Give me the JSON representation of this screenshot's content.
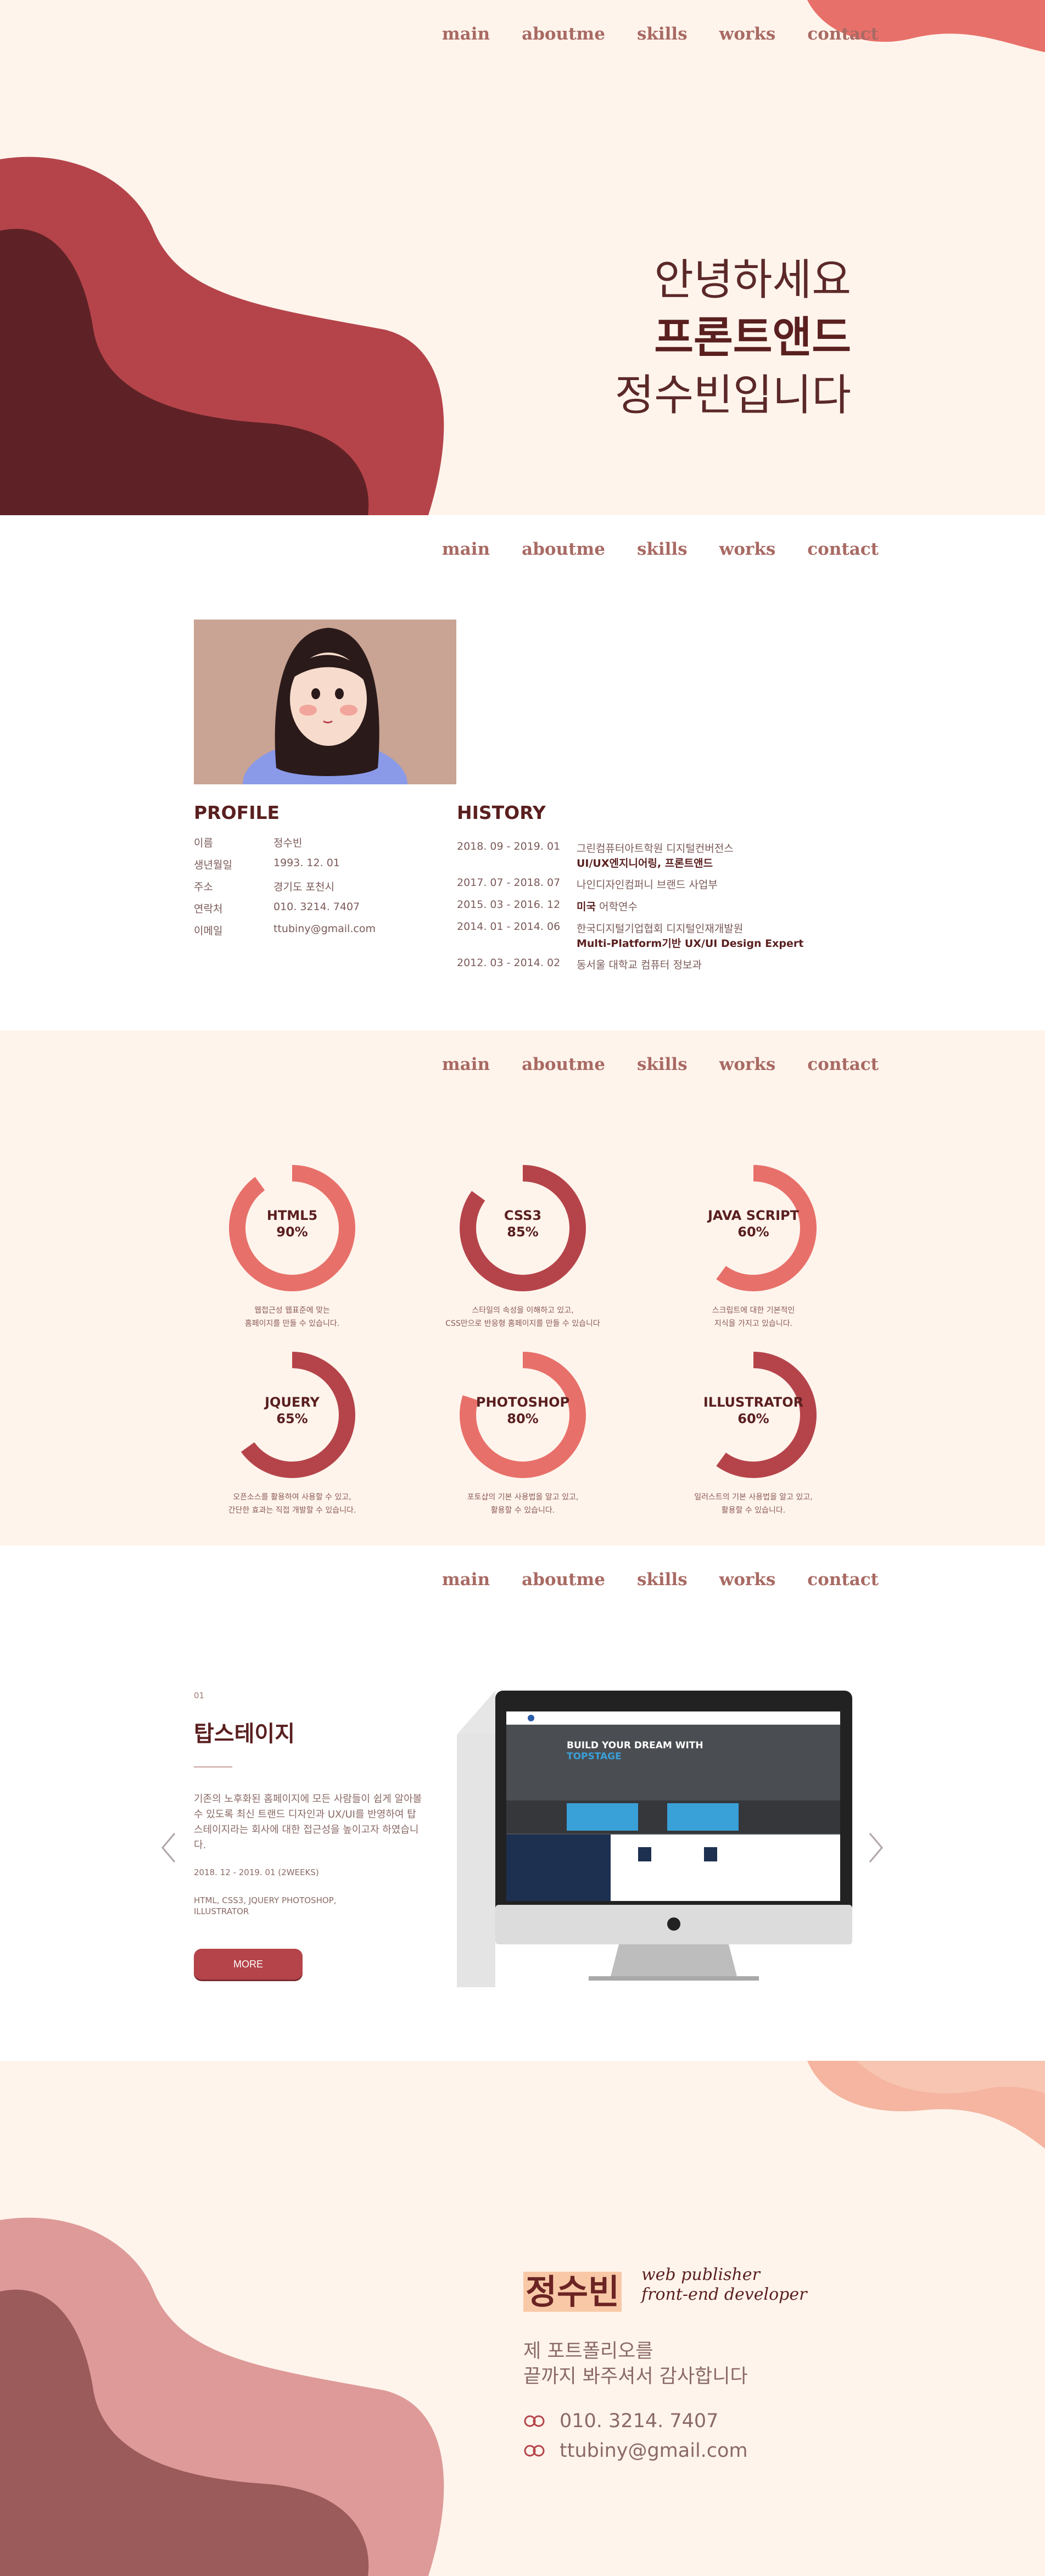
{
  "nav": [
    "main",
    "aboutme",
    "skills",
    "works",
    "contact"
  ],
  "hero": {
    "line1": "안녕하세요",
    "line2": "프론트앤드",
    "line3": "정수빈입니다"
  },
  "about": {
    "profile_title": "PROFILE",
    "history_title": "HISTORY",
    "profile": [
      {
        "label": "이름",
        "value": "정수빈"
      },
      {
        "label": "생년월일",
        "value": "1993. 12. 01"
      },
      {
        "label": "주소",
        "value": "경기도 포천시"
      },
      {
        "label": "연락처",
        "value": "010. 3214. 7407"
      },
      {
        "label": "이메일",
        "value": "ttubiny@gmail.com"
      }
    ],
    "history": [
      {
        "date": "2018. 09 - 2019. 01",
        "text": "그린컴퓨터아트학원 디지털컨버전스",
        "bold": "UI/UX엔지니어링, 프론트앤드"
      },
      {
        "date": "2017. 07 - 2018. 07",
        "text": "나인디자인컴퍼니 브랜드 사업부",
        "bold": ""
      },
      {
        "date": "2015. 03 - 2016. 12",
        "text": "어학연수",
        "bold_prefix": "미국"
      },
      {
        "date": "2014. 01 - 2014. 06",
        "text": "한국디지털기업협회 디지털인재개발원",
        "bold": "Multi-Platform기반 UX/UI Design Expert"
      },
      {
        "date": "2012. 03 - 2014. 02",
        "text": "동서울 대학교 컴퓨터 정보과",
        "bold": ""
      }
    ]
  },
  "skills": [
    {
      "name": "HTML5",
      "percent": "90%",
      "value": 0.9,
      "color": "#e8706a",
      "desc1": "웹접근성 웹표준에 맞는",
      "desc2": "홈페이지를 만들 수 있습니다."
    },
    {
      "name": "CSS3",
      "percent": "85%",
      "value": 0.85,
      "color": "#b5444a",
      "desc1": "스타일의 속성을 이해하고 있고,",
      "desc2": "CSS만으로 반응형 홈페이지를 만들 수 있습니다"
    },
    {
      "name": "JAVA SCRIPT",
      "percent": "60%",
      "value": 0.6,
      "color": "#e8706a",
      "desc1": "스크립트에 대한 기본적인",
      "desc2": "지식을 가지고 있습니다."
    },
    {
      "name": "JQUERY",
      "percent": "65%",
      "value": 0.65,
      "color": "#b5444a",
      "desc1": "오픈소스를 활용하여 사용할 수 있고,",
      "desc2": "간단한 효과는 직접 개발할 수 있습니다."
    },
    {
      "name": "PHOTOSHOP",
      "percent": "80%",
      "value": 0.8,
      "color": "#e8706a",
      "desc1": "포토샵의 기본 사용법을 알고 있고,",
      "desc2": "활용할 수 있습니다."
    },
    {
      "name": "ILLUSTRATOR",
      "percent": "60%",
      "value": 0.6,
      "color": "#b5444a",
      "desc1": "일러스트의 기본 사용법을 알고 있고,",
      "desc2": "활용할 수 있습니다."
    }
  ],
  "works": {
    "num": "01",
    "title": "탑스테이지",
    "desc": "기존의 노후화된 홈페이지에 모든 사람들이 쉽게 알아볼 수 있도록 최신 트랜드 디자인과 UX/UI를 반영하여 탑스테이지라는 회사에 대한 접근성을 높이고자 하였습니다.",
    "date": "2018. 12 - 2019. 01 (2WEEKS)",
    "tools": "HTML, CSS3, JQUERY PHOTOSHOP, ILLUSTRATOR",
    "more": "MORE",
    "screen_headline1": "BUILD YOUR DREAM WITH",
    "screen_headline2": "TOPSTAGE"
  },
  "contact": {
    "name": "정수빈",
    "role1": "web publisher",
    "role2": "front-end developer",
    "msg1": "제 포트폴리오를",
    "msg2": "끝까지 봐주셔서 감사합니다",
    "phone": "010. 3214. 7407",
    "email": "ttubiny@gmail.com"
  },
  "colors": {
    "accent": "#b5444a",
    "coral": "#e8706a",
    "dark": "#5a1f1f",
    "cream": "#fff4ec"
  }
}
